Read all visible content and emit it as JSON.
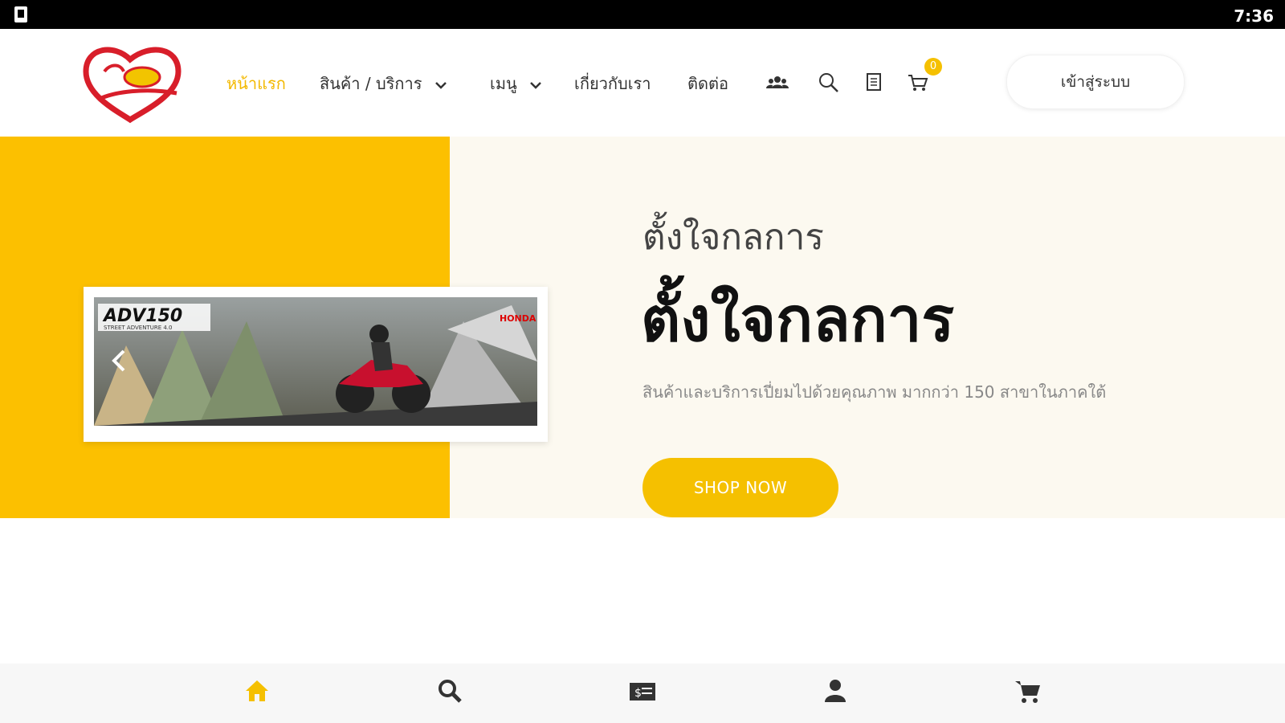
{
  "status_bar": {
    "time": "7:36"
  },
  "nav": {
    "items": [
      {
        "label": "หน้าแรก",
        "active": true
      },
      {
        "label": "สินค้า / บริการ",
        "has_dropdown": true
      },
      {
        "label": "เมนู",
        "has_dropdown": true
      },
      {
        "label": "เกี่ยวกับเรา"
      },
      {
        "label": "ติดต่อ"
      }
    ],
    "icons": [
      "users-icon",
      "search-icon",
      "document-icon",
      "cart-icon"
    ],
    "cart_count": "0",
    "login_label": "เข้าสู่ระบบ"
  },
  "hero": {
    "subtitle": "ตั้งใจกลการ",
    "title": "ตั้งใจกลการ",
    "description": "สินค้าและบริการเปี่ยมไปด้วยคุณภาพ มากกว่า 150 สาขาในภาคใต้",
    "cta_label": "SHOP NOW",
    "slide": {
      "model": "ADV150",
      "tagline": "STREET ADVENTURE 4.0",
      "brand": "HONDA"
    }
  },
  "bottom_nav": {
    "items": [
      "home-icon",
      "search-icon",
      "money-icon",
      "user-icon",
      "cart-icon"
    ],
    "active": "home-icon"
  },
  "colors": {
    "accent": "#f5c000",
    "hero_bg": "#fcf9f0",
    "text_dark": "#111111"
  }
}
